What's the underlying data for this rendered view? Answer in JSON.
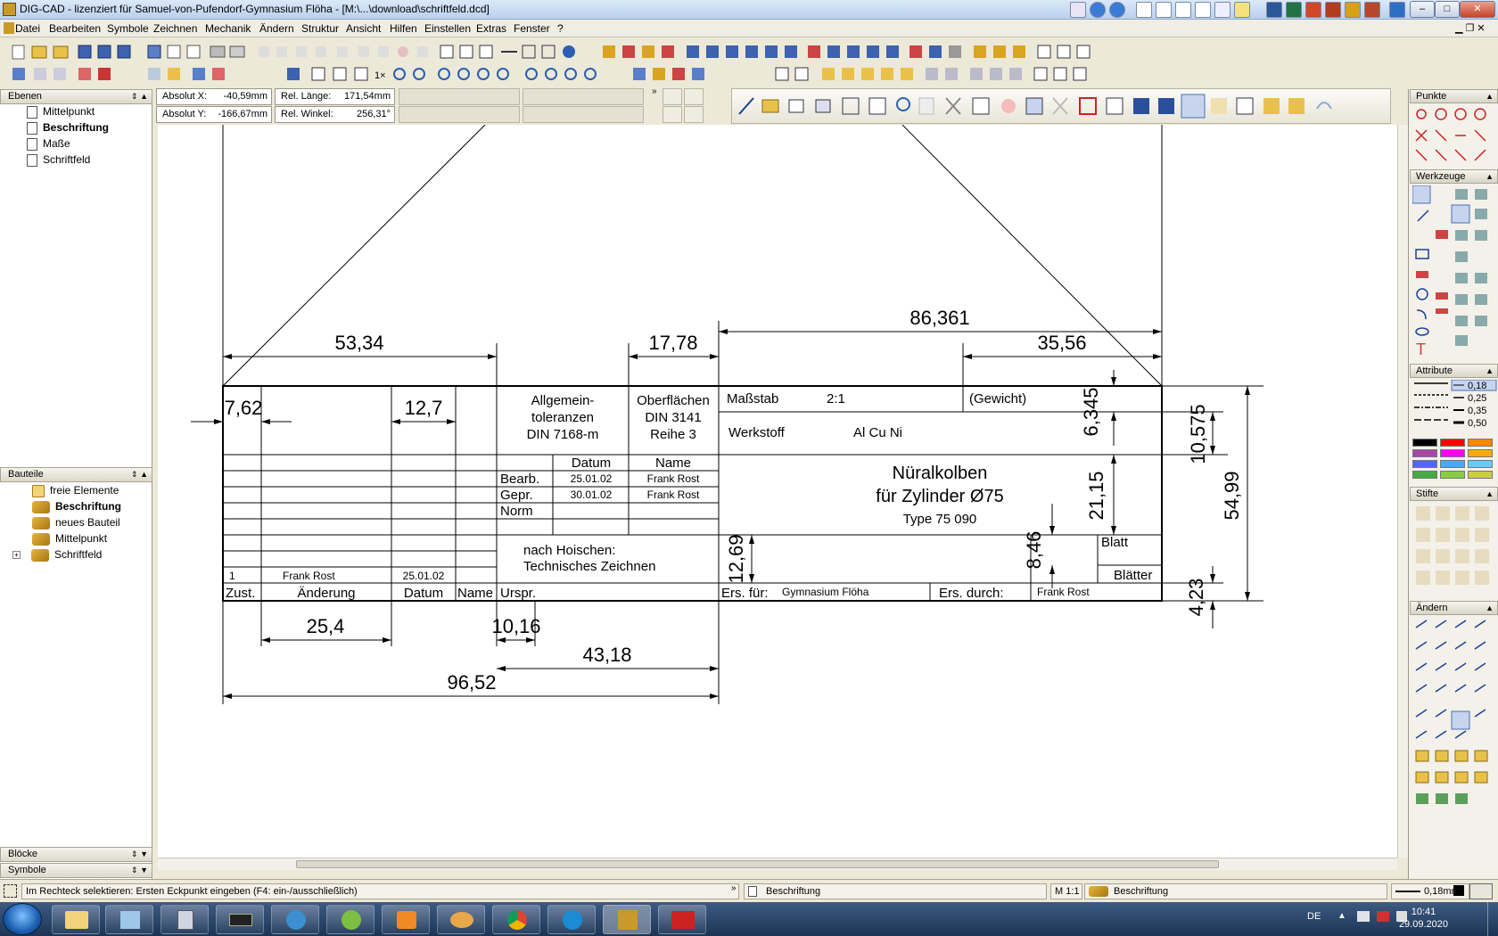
{
  "window": {
    "title": "DIG-CAD - lizenziert für Samuel-von-Pufendorf-Gymnasium Flöha - [M:\\...\\download\\schriftfeld.dcd]",
    "min": "–",
    "max": "□",
    "close": "✕"
  },
  "menu": [
    "Datei",
    "Bearbeiten",
    "Symbole",
    "Zeichnen",
    "Mechanik",
    "Ändern",
    "Struktur",
    "Ansicht",
    "Hilfen",
    "Einstellen",
    "Extras",
    "Fenster",
    "?"
  ],
  "coords": {
    "abs_x_label": "Absolut X:",
    "abs_x": "-40,59mm",
    "abs_y_label": "Absolut Y:",
    "abs_y": "-166,67mm",
    "rel_len_label": "Rel. Länge:",
    "rel_len": "171,54mm",
    "rel_ang_label": "Rel. Winkel:",
    "rel_ang": "256,31°"
  },
  "left_panel": {
    "ebenen": {
      "title": "Ebenen",
      "items": [
        "Mittelpunkt",
        "Beschriftung",
        "Maße",
        "Schriftfeld"
      ],
      "active": "Beschriftung"
    },
    "bauteile": {
      "title": "Bauteile",
      "items": [
        "freie Elemente",
        "Beschriftung",
        "neues Bauteil",
        "Mittelpunkt",
        "Schriftfeld"
      ],
      "active": "Beschriftung"
    },
    "bloecke": "Blöcke",
    "symbole": "Symbole"
  },
  "right_panel": {
    "punkte": "Punkte",
    "werkzeuge": "Werkzeuge",
    "attribute": "Attribute",
    "line_widths": [
      "0,18",
      "0,25",
      "0,35",
      "0,50"
    ],
    "stifte": "Stifte",
    "aendern": "Ändern",
    "colors": [
      "#000000",
      "#ff0000",
      "#ff8800",
      "#aa44aa",
      "#ff00ff",
      "#ffaa00",
      "#5566ff",
      "#44aaff",
      "#66ccff",
      "#44aa44",
      "#88cc44",
      "#cccc44"
    ]
  },
  "drawing": {
    "dims": {
      "d1": "53,34",
      "d2": "17,78",
      "d3": "86,361",
      "d4": "35,56",
      "d5": "7,62",
      "d6": "12,7",
      "d7": "6,345",
      "d8": "10,575",
      "d9": "21,15",
      "d10": "54,99",
      "d11": "12,69",
      "d12": "8,46",
      "d13": "4,23",
      "d14": "25,4",
      "d15": "10,16",
      "d16": "43,18",
      "d17": "96,52"
    },
    "cells": {
      "allg1": "Allgemein-",
      "allg2": "toleranzen",
      "allg3": "DIN 7168-m",
      "ober1": "Oberflächen",
      "ober2": "DIN 3141",
      "ober3": "Reihe 3",
      "massstab": "Maßstab",
      "massstab_val": "2:1",
      "gewicht": "(Gewicht)",
      "werkstoff": "Werkstoff",
      "werkstoff_val": "Al Cu Ni",
      "datum_h": "Datum",
      "name_h": "Name",
      "bearb": "Bearb.",
      "bearb_d": "25.01.02",
      "bearb_n": "Frank Rost",
      "gepr": "Gepr.",
      "gepr_d": "30.01.02",
      "gepr_n": "Frank Rost",
      "norm": "Norm",
      "t1": "Nüralkolben",
      "t2": "für Zylinder Ø75",
      "t3": "Type 75 090",
      "quelle1": "nach Hoischen:",
      "quelle2": "Technisches Zeichnen",
      "blatt": "Blatt",
      "blaetter": "Blätter",
      "rev_nr": "1",
      "rev_name": "Frank Rost",
      "rev_date": "25.01.02",
      "zust": "Zust.",
      "aend": "Änderung",
      "datum": "Datum",
      "name": "Name",
      "urspr": "Urspr.",
      "ers_fuer": "Ers. für:",
      "ers_fuer_val": "Gymnasium Flöha",
      "ers_durch": "Ers. durch:",
      "ers_durch_val": "Frank Rost"
    }
  },
  "status": {
    "hint": "Im Rechteck selektieren: Ersten Eckpunkt eingeben (F4: ein-/ausschließlich)",
    "layer": "Beschriftung",
    "scale": "M 1:1",
    "part": "Beschriftung",
    "pen": "0,18mm"
  },
  "taskbar": {
    "lang": "DE",
    "time": "10:41",
    "date": "29.09.2020"
  }
}
